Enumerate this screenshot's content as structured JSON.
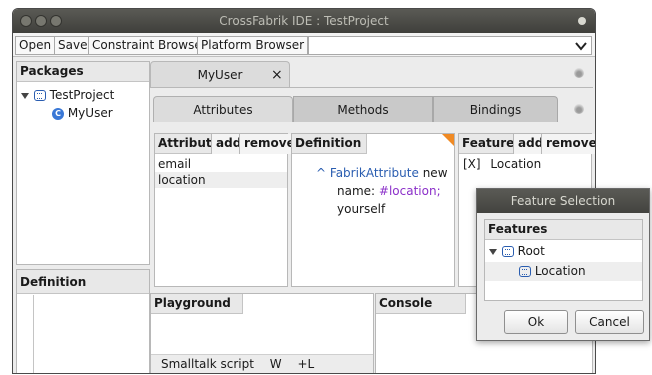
{
  "window": {
    "title": "CrossFabrik IDE : TestProject"
  },
  "toolbar": {
    "open": "Open",
    "save": "Save",
    "constraint_browser": "Constraint Browser",
    "platform_browser": "Platform Browser",
    "dropdown_value": ""
  },
  "packages": {
    "header": "Packages",
    "project": "TestProject",
    "class_item": "MyUser"
  },
  "left_definition": {
    "header": "Definition"
  },
  "editor": {
    "tab": "MyUser",
    "tab_close": "×",
    "subtabs": [
      "Attributes",
      "Methods",
      "Bindings"
    ],
    "attributes": {
      "header": "Attributes",
      "add": "add",
      "remove": "remove",
      "items": [
        "email",
        "location"
      ]
    },
    "definition": {
      "header": "Definition",
      "caret": "^",
      "class_name": "FabrikAttribute",
      "msg_new": "new",
      "keyword": "name:",
      "symbol": "#location;",
      "line3": "yourself"
    },
    "features": {
      "header": "Features",
      "add": "add",
      "remove": "remove",
      "item_mark": "[X]",
      "item_name": "Location"
    }
  },
  "playground": {
    "header": "Playground",
    "footer_label": "Smalltalk script",
    "footer_w": "W",
    "footer_l": "+L"
  },
  "console": {
    "header": "Console"
  },
  "dialog": {
    "title": "Feature Selection",
    "header": "Features",
    "root": "Root",
    "child": "Location",
    "ok": "Ok",
    "cancel": "Cancel"
  },
  "icons": {
    "close": "×-icon",
    "dropdown": "chevron-down-icon",
    "expand": "triangle-down-icon",
    "class": "class-icon",
    "package": "package-icon"
  },
  "colors": {
    "symbol": "#8b2fc9",
    "class_name": "#2a5db0",
    "titlebar_text": "#bdbdb5"
  }
}
